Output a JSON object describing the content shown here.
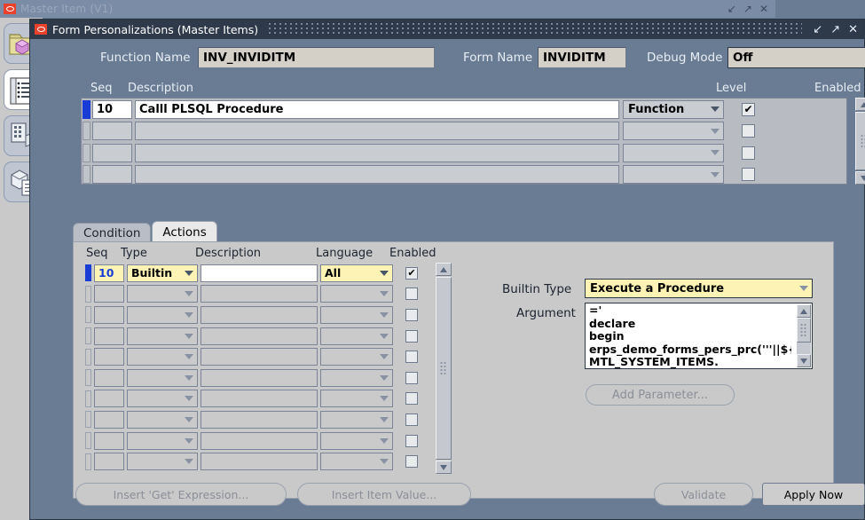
{
  "background_window": {
    "title": "Master Item (V1)",
    "controls": [
      "minimize",
      "maximize",
      "close"
    ],
    "sidebar_icons": [
      "folder-cube-icon",
      "list-document-icon",
      "organization-icon",
      "cube-list-icon"
    ]
  },
  "dialog": {
    "title": "Form Personalizations (Master Items)",
    "controls": [
      "minimize",
      "maximize",
      "close"
    ],
    "header": {
      "function_name_label": "Function Name",
      "function_name_value": "INV_INVIDITM",
      "form_name_label": "Form Name",
      "form_name_value": "INVIDITM",
      "debug_mode_label": "Debug Mode",
      "debug_mode_value": "Off"
    },
    "master_grid": {
      "columns": [
        "Seq",
        "Description",
        "Level",
        "Enabled"
      ],
      "rows": [
        {
          "seq": "10",
          "description": "Calll PLSQL Procedure",
          "level": "Function",
          "enabled": "✔",
          "selected": true
        },
        {
          "seq": "",
          "description": "",
          "level": "",
          "enabled": "",
          "selected": false
        },
        {
          "seq": "",
          "description": "",
          "level": "",
          "enabled": "",
          "selected": false
        },
        {
          "seq": "",
          "description": "",
          "level": "",
          "enabled": "",
          "selected": false
        }
      ]
    },
    "tabs": [
      {
        "label": "Condition",
        "active": false
      },
      {
        "label": "Actions",
        "active": true
      }
    ],
    "actions_grid": {
      "columns": [
        "Seq",
        "Type",
        "Description",
        "Language",
        "Enabled"
      ],
      "rows": [
        {
          "seq": "10",
          "type": "Builtin",
          "description": "",
          "language": "All",
          "enabled": "✔",
          "selected": true
        },
        {
          "seq": "",
          "type": "",
          "description": "",
          "language": "",
          "enabled": "",
          "selected": false
        },
        {
          "seq": "",
          "type": "",
          "description": "",
          "language": "",
          "enabled": "",
          "selected": false
        },
        {
          "seq": "",
          "type": "",
          "description": "",
          "language": "",
          "enabled": "",
          "selected": false
        },
        {
          "seq": "",
          "type": "",
          "description": "",
          "language": "",
          "enabled": "",
          "selected": false
        },
        {
          "seq": "",
          "type": "",
          "description": "",
          "language": "",
          "enabled": "",
          "selected": false
        },
        {
          "seq": "",
          "type": "",
          "description": "",
          "language": "",
          "enabled": "",
          "selected": false
        },
        {
          "seq": "",
          "type": "",
          "description": "",
          "language": "",
          "enabled": "",
          "selected": false
        },
        {
          "seq": "",
          "type": "",
          "description": "",
          "language": "",
          "enabled": "",
          "selected": false
        },
        {
          "seq": "",
          "type": "",
          "description": "",
          "language": "",
          "enabled": "",
          "selected": false
        }
      ]
    },
    "detail": {
      "builtin_type_label": "Builtin Type",
      "builtin_type_value": "Execute a Procedure",
      "argument_label": "Argument",
      "argument_value": "='\ndeclare\nbegin\nerps_demo_forms_pers_prc('''||${item.\nMTL_SYSTEM_ITEMS.\nINVENTORY_ITEM_ND.value}||'''",
      "add_parameter_label": "Add Parameter...",
      "add_parameter_enabled": false
    },
    "buttons": [
      {
        "label": "Insert 'Get' Expression...",
        "enabled": false
      },
      {
        "label": "Insert Item Value...",
        "enabled": false
      },
      {
        "label": "Validate",
        "enabled": false
      },
      {
        "label": "Apply Now",
        "enabled": true
      }
    ]
  },
  "colors": {
    "dialog_chrome": "#6a7b94",
    "titlebar_active": "#2e3a4a",
    "titlebar_inactive": "#7b8ca6",
    "panel": "#c9c9c9",
    "field_highlight": "#fdf3b4",
    "selection_marker": "#1a3cd6",
    "oracle_red": "#e8412c"
  }
}
